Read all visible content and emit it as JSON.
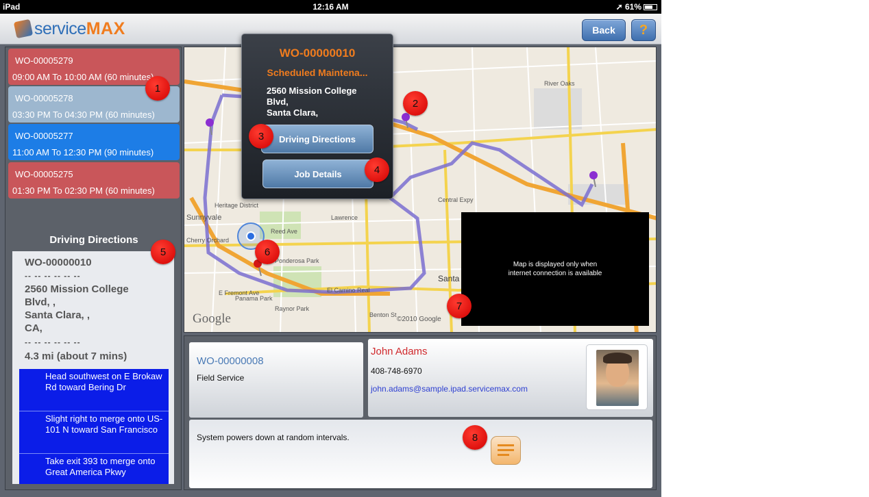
{
  "status_bar": {
    "device": "iPad",
    "time": "12:16 AM",
    "battery": "61%"
  },
  "header": {
    "logo_part1": "service",
    "logo_part2": "max",
    "back_label": "Back",
    "help_label": "?"
  },
  "work_orders": [
    {
      "id": "WO-00005279",
      "time": "09:00 AM To 10:00 AM (60 minutes)",
      "color": "#c9565a"
    },
    {
      "id": "WO-00005278",
      "time": "03:30 PM To 04:30 PM (60 minutes)",
      "color": "#9db7cf"
    },
    {
      "id": "WO-00005277",
      "time": "11:00 AM To 12:30 PM (90 minutes)",
      "color": "#1d7de6"
    },
    {
      "id": "WO-00005275",
      "time": "01:30 PM To 02:30 PM (60 minutes)",
      "color": "#c9565a"
    }
  ],
  "directions": {
    "title": "Driving Directions",
    "wo_id": "WO-00000010",
    "separator": "-- -- -- -- -- --",
    "address_lines": [
      "2560 Mission College",
      "Blvd, ,",
      "Santa Clara, ,",
      "CA,"
    ],
    "distance": "4.3 mi (about 7 mins)",
    "steps": [
      "Head southwest on E Brokaw Rd toward Bering Dr",
      "Slight right to merge onto US-101 N toward San Francisco",
      "Take exit 393 to merge onto Great America Pkwy"
    ]
  },
  "map": {
    "offline_line1": "Map is displayed only when",
    "offline_line2": "internet connection is available",
    "google_label": "Google",
    "copyright": "©2010 Google",
    "labels": [
      "Sunnyvale",
      "Heritage District",
      "Cherry Orchard",
      "Lawrence",
      "Santa",
      "River Oaks",
      "Ponderosa Park",
      "Panama Park",
      "Raynor Park",
      "El Camino Real",
      "Central Expy",
      "Reed Ave",
      "E Fremont Ave",
      "Benton St"
    ]
  },
  "popup": {
    "wo_id": "WO-00000010",
    "type": "Scheduled Maintena...",
    "address_lines": [
      "2560 Mission College",
      "Blvd,",
      "Santa Clara,"
    ],
    "btn_directions": "Driving Directions",
    "btn_job": "Job Details"
  },
  "detail": {
    "wo_id": "WO-00000008",
    "wo_type": "Field Service",
    "contact_name": "John Adams",
    "contact_phone": "408-748-6970",
    "contact_email": "john.adams@sample.ipad.servicemax.com",
    "description": "System powers down at random intervals."
  },
  "callouts": [
    "1",
    "2",
    "3",
    "4",
    "5",
    "6",
    "7",
    "8"
  ],
  "colors": {
    "accent_orange": "#f07c1e",
    "brand_blue": "#2f6fb8",
    "route": "#7a6fd0",
    "step_blue": "#0b1de8"
  }
}
